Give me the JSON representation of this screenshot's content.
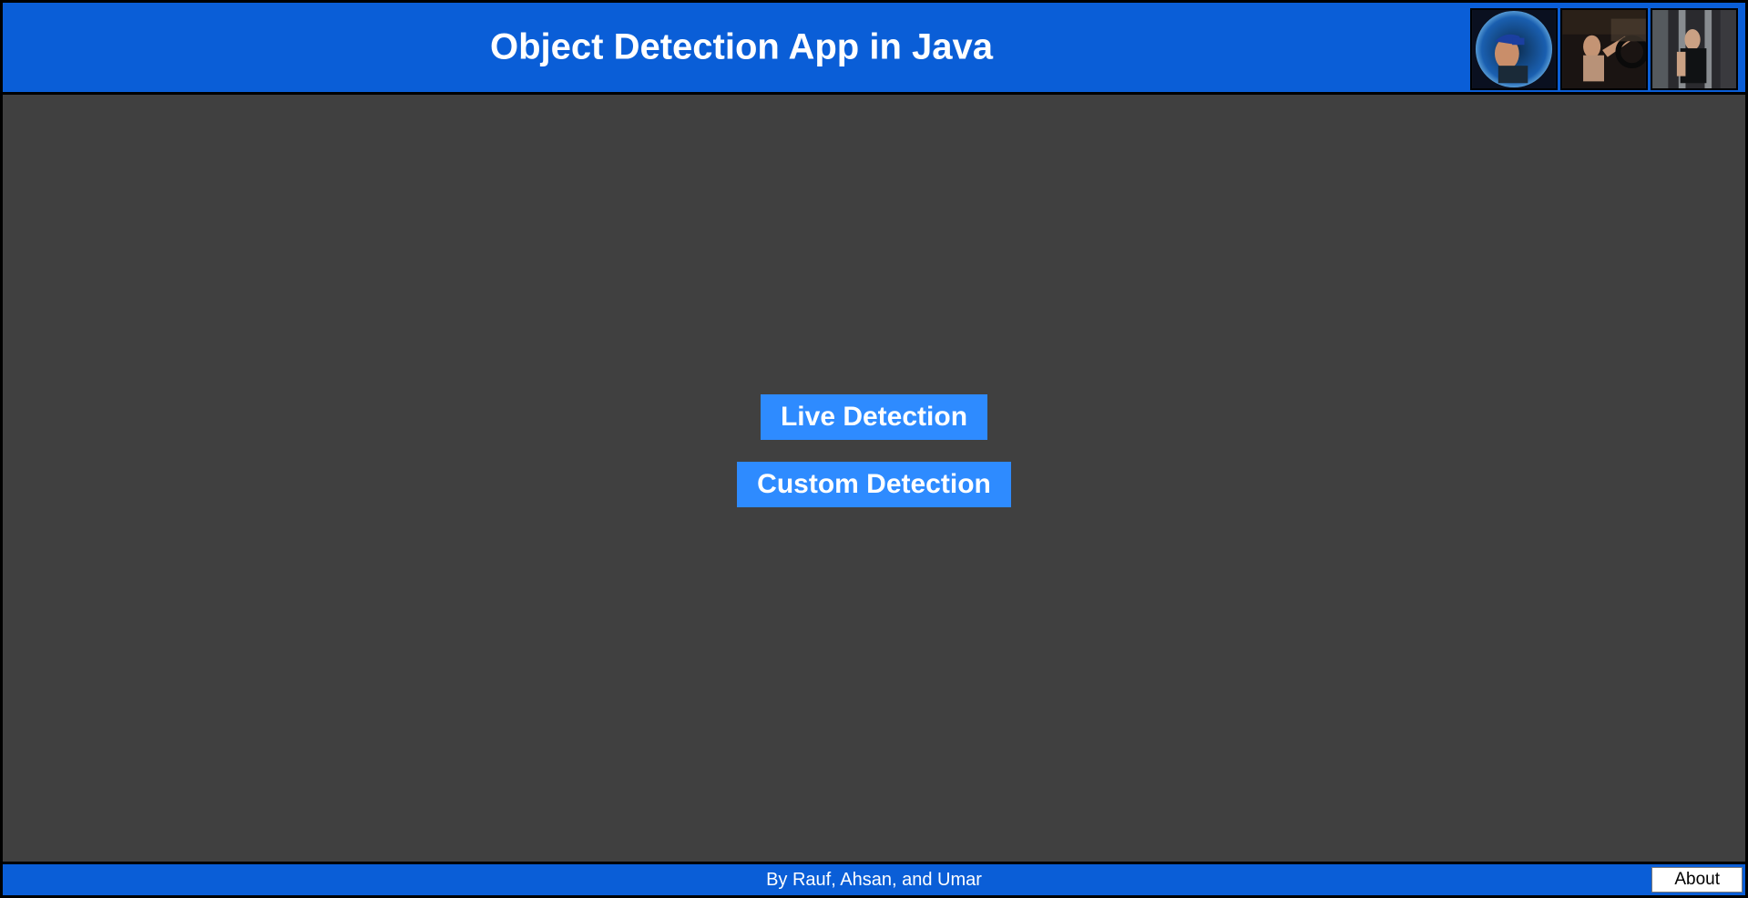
{
  "header": {
    "title": "Object Detection App in Java",
    "thumbnails": [
      {
        "name": "thumbnail-1"
      },
      {
        "name": "thumbnail-2"
      },
      {
        "name": "thumbnail-3"
      }
    ]
  },
  "main": {
    "buttons": {
      "live_detection_label": "Live Detection",
      "custom_detection_label": "Custom Detection"
    }
  },
  "footer": {
    "credits": "By Rauf, Ahsan, and Umar",
    "about_label": "About"
  },
  "colors": {
    "header_bg": "#0a5ed7",
    "main_bg": "#404040",
    "button_bg": "#2e8bff",
    "border": "#000000"
  }
}
